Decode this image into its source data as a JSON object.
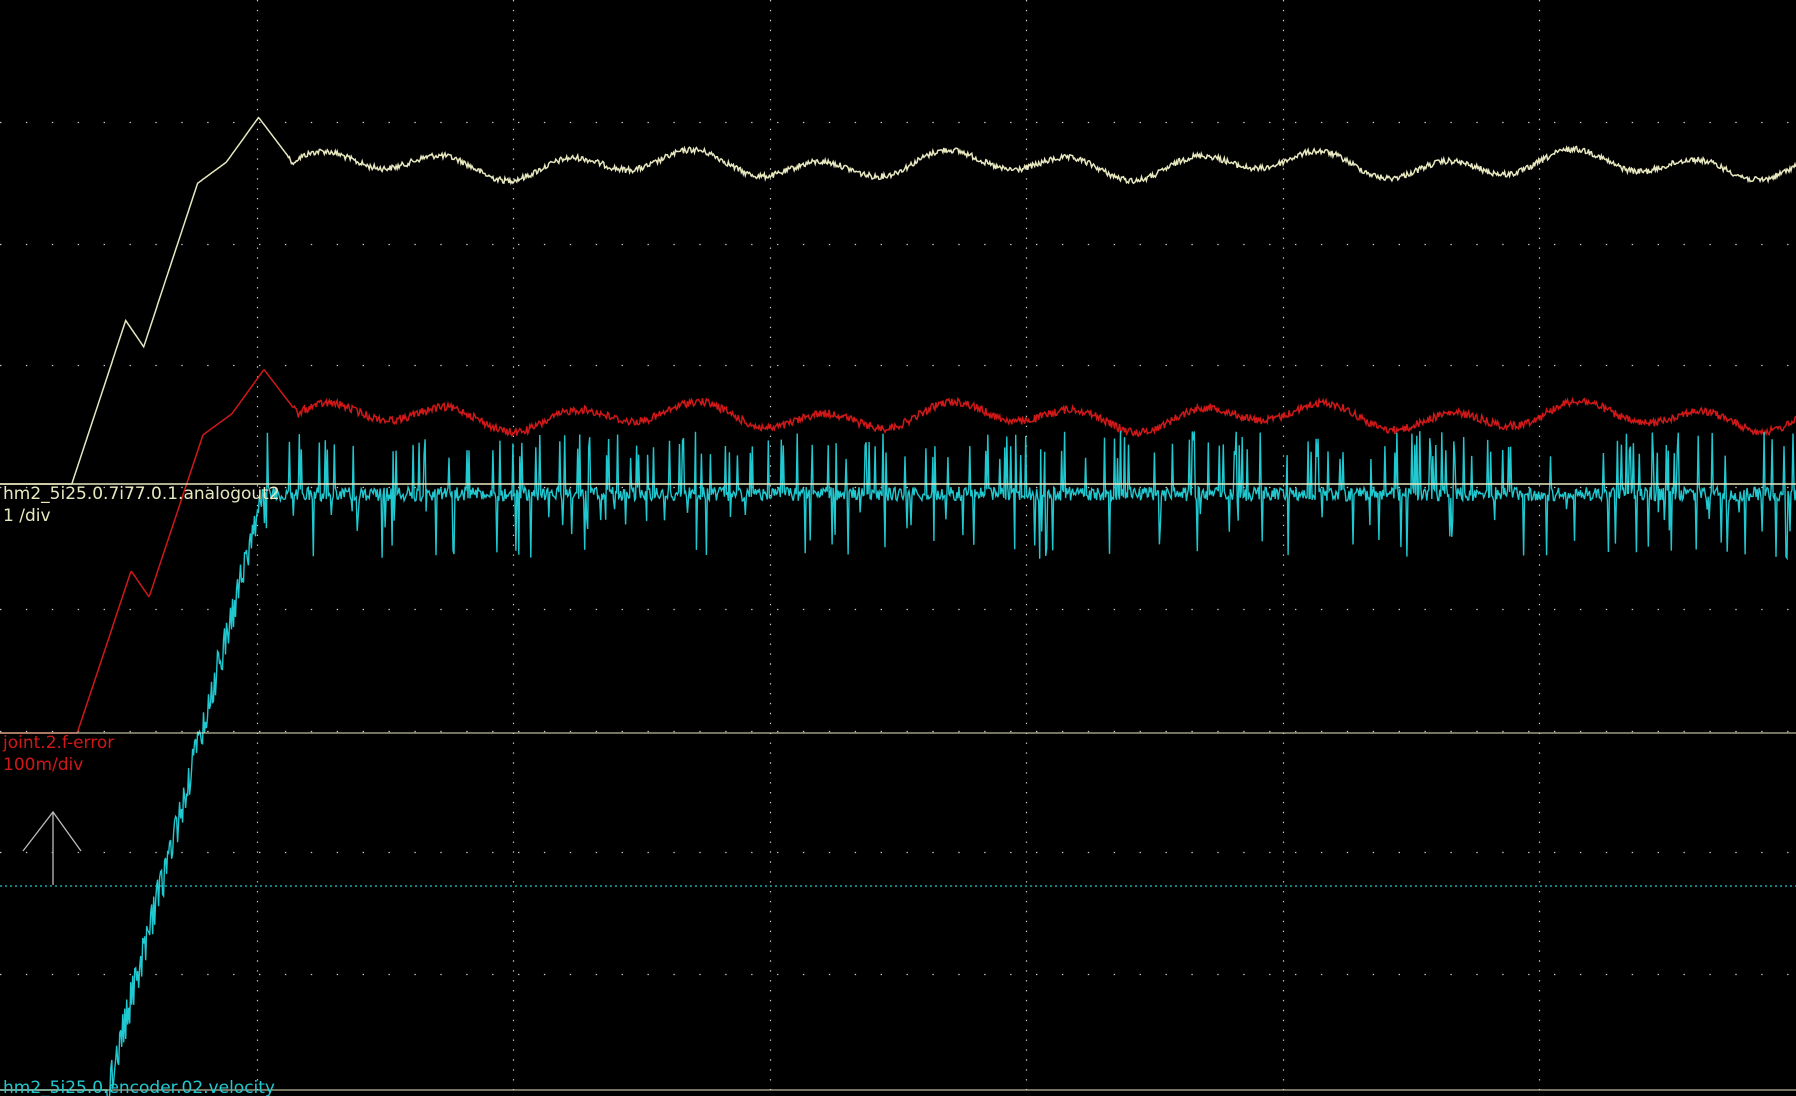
{
  "colors": {
    "background": "#000000",
    "grid": "#c8c8c8",
    "analog": "#e8e8c0",
    "ferror": "#d01818",
    "velocity": "#20c8d0",
    "trigger_line": "#20c8d0",
    "trigger_arrow": "#bbbbbb"
  },
  "chart_data": {
    "type": "line",
    "title": "",
    "xlabel": "",
    "ylabel": "",
    "grid": true,
    "x": [
      0,
      20,
      40,
      60,
      80,
      100
    ],
    "series": [
      {
        "name": "hm2_5i25.0.7i77.0.1.analogout2",
        "scale": "1 /div",
        "values": [
          -0.1,
          6.9,
          6.3,
          6.1,
          6.2,
          6.1
        ]
      },
      {
        "name": "joint.2.f-error",
        "scale": "100m/div",
        "values": [
          0.0,
          8.7,
          7.8,
          7.7,
          7.8,
          7.7
        ]
      },
      {
        "name": "hm2_5i25.0.encoder.02.velocity",
        "values": [
          -1.6,
          6.8,
          6.9,
          7.0,
          6.9,
          7.0
        ]
      }
    ]
  }
}
